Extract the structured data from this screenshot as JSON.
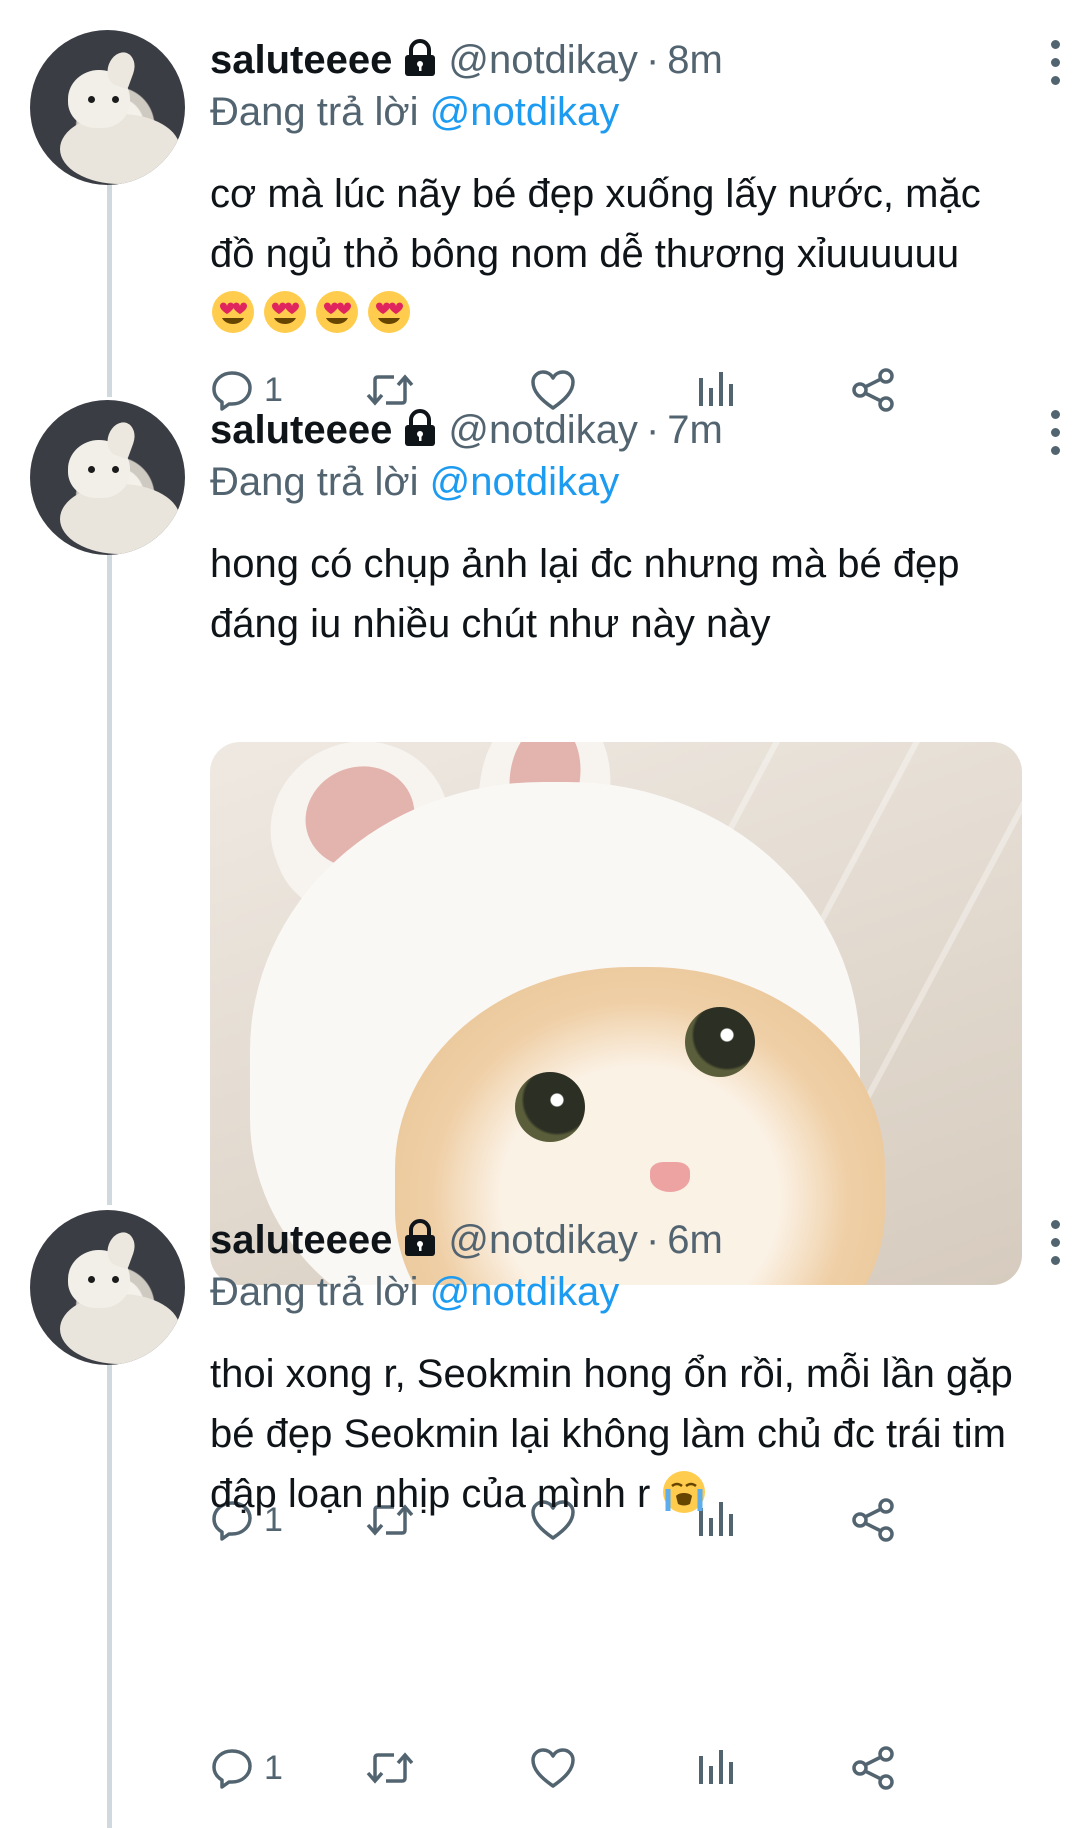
{
  "tweets": [
    {
      "display_name": "saluteeee",
      "handle": "@notdikay",
      "separator": "·",
      "time": "8m",
      "reply_prefix": "Đang trả lời",
      "reply_mention": "@notdikay",
      "text": "cơ mà lúc nãy bé đẹp xuống lấy nước, mặc đồ ngủ thỏ bông nom dễ thương xỉuuuuuu",
      "emojis": [
        "heart-eyes-emoji",
        "heart-eyes-emoji",
        "heart-eyes-emoji",
        "heart-eyes-emoji"
      ],
      "reply_count": "1",
      "has_photo": false
    },
    {
      "display_name": "saluteeee",
      "handle": "@notdikay",
      "separator": "·",
      "time": "7m",
      "reply_prefix": "Đang trả lời",
      "reply_mention": "@notdikay",
      "text": "hong có chụp ảnh lại đc nhưng mà bé đẹp đáng iu nhiều chút như này này",
      "reply_count": "1",
      "has_photo": true,
      "photo_subject": "white kitten wearing bunny ears hat"
    },
    {
      "display_name": "saluteeee",
      "handle": "@notdikay",
      "separator": "·",
      "time": "6m",
      "reply_prefix": "Đang trả lời",
      "reply_mention": "@notdikay",
      "text": "thoi xong r, Seokmin hong ổn rồi, mỗi lần gặp bé đẹp Seokmin lại không làm chủ đc trái tim đập loạn nhịp của mình r",
      "emojis": [
        "crying-emoji"
      ],
      "reply_count": "1",
      "has_photo": false
    }
  ],
  "colors": {
    "text_primary": "#0f1419",
    "text_secondary": "#536471",
    "accent": "#1d9bf0",
    "thread_line": "#cfd9de"
  },
  "icons": {
    "reply": "reply-icon",
    "retweet": "retweet-icon",
    "like": "heart-icon",
    "analytics": "analytics-icon",
    "share": "share-icon",
    "protected": "lock-icon",
    "more": "more-vertical-icon"
  }
}
